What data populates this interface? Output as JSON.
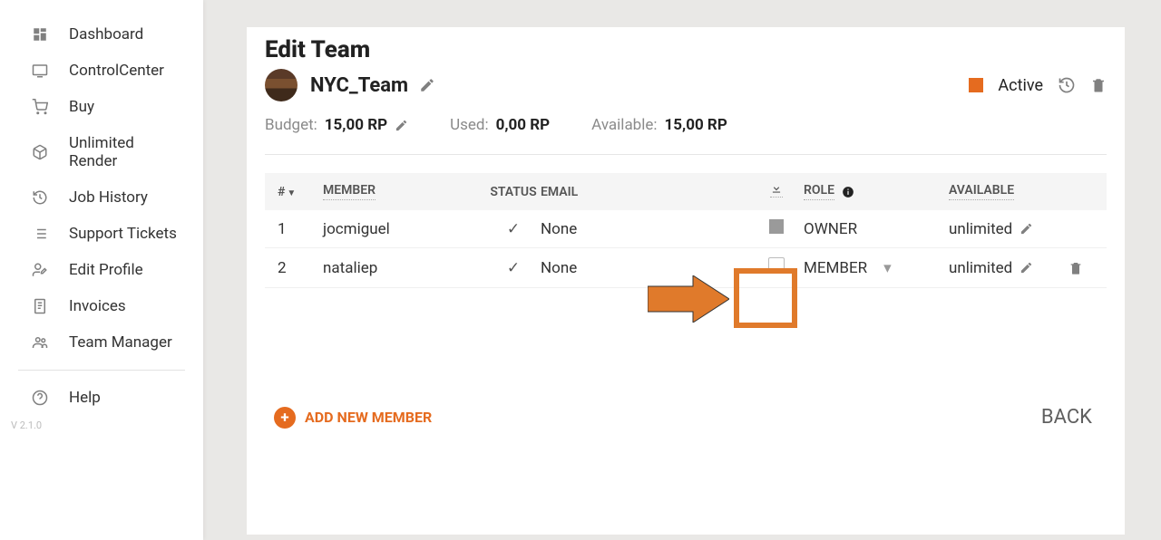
{
  "sidebar": {
    "items": [
      {
        "label": "Dashboard",
        "icon": "dashboard-icon"
      },
      {
        "label": "ControlCenter",
        "icon": "monitor-icon"
      },
      {
        "label": "Buy",
        "icon": "cart-icon"
      },
      {
        "label": "Unlimited Render",
        "icon": "box-icon"
      },
      {
        "label": "Job History",
        "icon": "history-icon"
      },
      {
        "label": "Support Tickets",
        "icon": "list-icon"
      },
      {
        "label": "Edit Profile",
        "icon": "user-edit-icon"
      },
      {
        "label": "Invoices",
        "icon": "receipt-icon"
      },
      {
        "label": "Team Manager",
        "icon": "users-icon"
      }
    ],
    "help_label": "Help",
    "version": "V 2.1.0"
  },
  "page": {
    "title": "Edit Team",
    "team_name": "NYC_Team",
    "status": {
      "label": "Active"
    },
    "budget": {
      "budget_label": "Budget:",
      "budget_value": "15,00 RP",
      "used_label": "Used:",
      "used_value": "0,00 RP",
      "available_label": "Available:",
      "available_value": "15,00 RP"
    },
    "table": {
      "headers": {
        "index": "#",
        "member": "MEMBER",
        "status": "STATUS",
        "email": "EMAIL",
        "role": "ROLE",
        "available": "AVAILABLE"
      },
      "rows": [
        {
          "idx": "1",
          "member": "jocmiguel",
          "email": "None",
          "role": "OWNER",
          "available": "unlimited"
        },
        {
          "idx": "2",
          "member": "nataliep",
          "email": "None",
          "role": "MEMBER",
          "available": "unlimited"
        }
      ]
    },
    "add_member_label": "ADD NEW MEMBER",
    "back_label": "BACK"
  }
}
